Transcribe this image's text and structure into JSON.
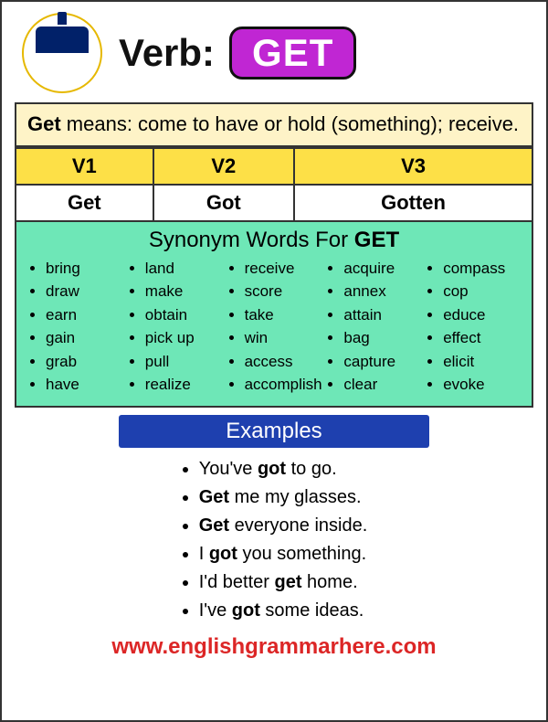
{
  "header": {
    "label": "Verb:",
    "word": "GET"
  },
  "definition": {
    "term": "Get",
    "meaning_rest": " means: come to have or hold (something); receive."
  },
  "forms": {
    "headers": [
      "V1",
      "V2",
      "V3"
    ],
    "values": [
      "Get",
      "Got",
      "Gotten"
    ]
  },
  "synonyms": {
    "title_prefix": "Synonym Words For ",
    "title_word": "GET",
    "cols": [
      [
        "bring",
        "draw",
        "earn",
        "gain",
        "grab",
        "have"
      ],
      [
        "land",
        "make",
        "obtain",
        "pick up",
        "pull",
        "realize"
      ],
      [
        "receive",
        "score",
        "take",
        "win",
        "access",
        "accomplish"
      ],
      [
        "acquire",
        "annex",
        "attain",
        "bag",
        "capture",
        "clear"
      ],
      [
        "compass",
        "cop",
        "educe",
        "effect",
        "elicit",
        "evoke"
      ]
    ]
  },
  "examples": {
    "header": "Examples",
    "items": [
      {
        "pre": "You've ",
        "bold": "got",
        "post": " to go."
      },
      {
        "pre": "",
        "bold": "Get",
        "post": " me my glasses."
      },
      {
        "pre": "",
        "bold": "Get",
        "post": " everyone inside."
      },
      {
        "pre": "I ",
        "bold": "got",
        "post": " you something."
      },
      {
        "pre": "I'd better ",
        "bold": "get",
        "post": " home."
      },
      {
        "pre": "I've ",
        "bold": "got",
        "post": " some ideas."
      }
    ]
  },
  "footer": {
    "url": "www.englishgrammarhere.com"
  }
}
